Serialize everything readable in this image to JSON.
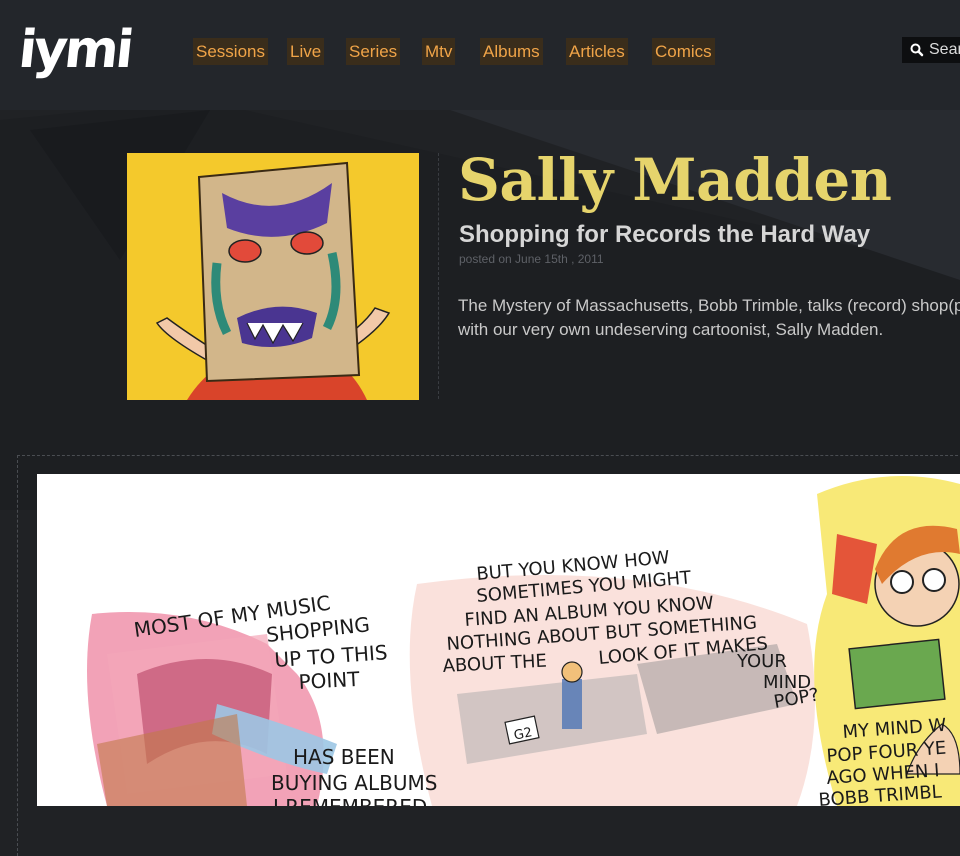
{
  "site": {
    "logo": "iymi"
  },
  "nav": {
    "items": [
      {
        "label": "Sessions"
      },
      {
        "label": "Live"
      },
      {
        "label": "Series"
      },
      {
        "label": "Mtv"
      },
      {
        "label": "Albums"
      },
      {
        "label": "Articles"
      },
      {
        "label": "Comics"
      }
    ]
  },
  "search": {
    "placeholder": "Search"
  },
  "article": {
    "title": "Sally Madden",
    "subtitle": "Shopping for Records the Hard Way",
    "posted": "posted on June 15th , 2011",
    "description_line1": "The Mystery of Massachusetts, Bobb Trimble, talks (record) shop(ping)",
    "description_line2": "with our very own undeserving cartoonist, Sally Madden."
  },
  "comic": {
    "panel1": {
      "line1": "MOST OF MY MUSIC",
      "line2": "SHOPPING",
      "line3": "UP TO THIS",
      "line4": "POINT",
      "line5": "HAS BEEN",
      "line6": "BUYING ALBUMS",
      "line7": "I REMEMBERED"
    },
    "panel2": {
      "line1": "BUT YOU KNOW HOW",
      "line2": "SOMETIMES YOU MIGHT",
      "line3": "FIND AN ALBUM YOU KNOW",
      "line4": "NOTHING ABOUT BUT SOMETHING",
      "line5": "ABOUT THE",
      "line6": "LOOK OF IT MAKES",
      "line7": "YOUR",
      "line8": "MIND",
      "line9": "POP?",
      "sign": "G2"
    },
    "panel3": {
      "line1": "MY MIND W",
      "line2": "POP FOUR YE",
      "line3": "AGO WHEN I",
      "line4": "BOBB TRIMBL"
    }
  },
  "colors": {
    "background": "#202225",
    "nav_text": "#f0a448",
    "nav_bg": "#3a2d1b",
    "title": "#e6d46c"
  }
}
